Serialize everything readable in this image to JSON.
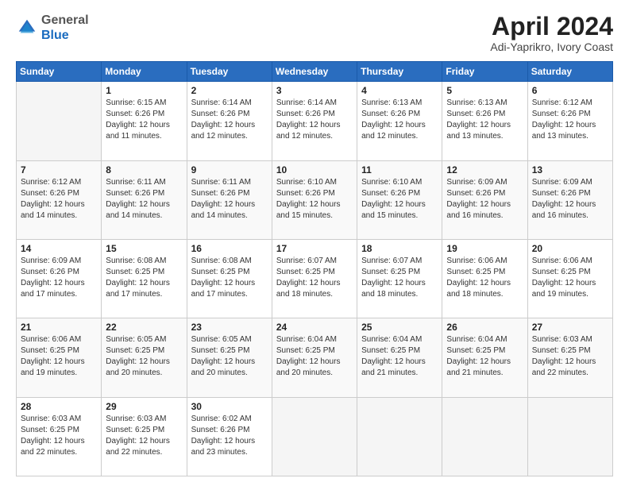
{
  "header": {
    "logo_line1": "General",
    "logo_line2": "Blue",
    "month_title": "April 2024",
    "location": "Adi-Yaprikro, Ivory Coast"
  },
  "weekdays": [
    "Sunday",
    "Monday",
    "Tuesday",
    "Wednesday",
    "Thursday",
    "Friday",
    "Saturday"
  ],
  "weeks": [
    [
      {
        "day": "",
        "info": ""
      },
      {
        "day": "1",
        "info": "Sunrise: 6:15 AM\nSunset: 6:26 PM\nDaylight: 12 hours\nand 11 minutes."
      },
      {
        "day": "2",
        "info": "Sunrise: 6:14 AM\nSunset: 6:26 PM\nDaylight: 12 hours\nand 12 minutes."
      },
      {
        "day": "3",
        "info": "Sunrise: 6:14 AM\nSunset: 6:26 PM\nDaylight: 12 hours\nand 12 minutes."
      },
      {
        "day": "4",
        "info": "Sunrise: 6:13 AM\nSunset: 6:26 PM\nDaylight: 12 hours\nand 12 minutes."
      },
      {
        "day": "5",
        "info": "Sunrise: 6:13 AM\nSunset: 6:26 PM\nDaylight: 12 hours\nand 13 minutes."
      },
      {
        "day": "6",
        "info": "Sunrise: 6:12 AM\nSunset: 6:26 PM\nDaylight: 12 hours\nand 13 minutes."
      }
    ],
    [
      {
        "day": "7",
        "info": "Sunrise: 6:12 AM\nSunset: 6:26 PM\nDaylight: 12 hours\nand 14 minutes."
      },
      {
        "day": "8",
        "info": "Sunrise: 6:11 AM\nSunset: 6:26 PM\nDaylight: 12 hours\nand 14 minutes."
      },
      {
        "day": "9",
        "info": "Sunrise: 6:11 AM\nSunset: 6:26 PM\nDaylight: 12 hours\nand 14 minutes."
      },
      {
        "day": "10",
        "info": "Sunrise: 6:10 AM\nSunset: 6:26 PM\nDaylight: 12 hours\nand 15 minutes."
      },
      {
        "day": "11",
        "info": "Sunrise: 6:10 AM\nSunset: 6:26 PM\nDaylight: 12 hours\nand 15 minutes."
      },
      {
        "day": "12",
        "info": "Sunrise: 6:09 AM\nSunset: 6:26 PM\nDaylight: 12 hours\nand 16 minutes."
      },
      {
        "day": "13",
        "info": "Sunrise: 6:09 AM\nSunset: 6:26 PM\nDaylight: 12 hours\nand 16 minutes."
      }
    ],
    [
      {
        "day": "14",
        "info": "Sunrise: 6:09 AM\nSunset: 6:26 PM\nDaylight: 12 hours\nand 17 minutes."
      },
      {
        "day": "15",
        "info": "Sunrise: 6:08 AM\nSunset: 6:25 PM\nDaylight: 12 hours\nand 17 minutes."
      },
      {
        "day": "16",
        "info": "Sunrise: 6:08 AM\nSunset: 6:25 PM\nDaylight: 12 hours\nand 17 minutes."
      },
      {
        "day": "17",
        "info": "Sunrise: 6:07 AM\nSunset: 6:25 PM\nDaylight: 12 hours\nand 18 minutes."
      },
      {
        "day": "18",
        "info": "Sunrise: 6:07 AM\nSunset: 6:25 PM\nDaylight: 12 hours\nand 18 minutes."
      },
      {
        "day": "19",
        "info": "Sunrise: 6:06 AM\nSunset: 6:25 PM\nDaylight: 12 hours\nand 18 minutes."
      },
      {
        "day": "20",
        "info": "Sunrise: 6:06 AM\nSunset: 6:25 PM\nDaylight: 12 hours\nand 19 minutes."
      }
    ],
    [
      {
        "day": "21",
        "info": "Sunrise: 6:06 AM\nSunset: 6:25 PM\nDaylight: 12 hours\nand 19 minutes."
      },
      {
        "day": "22",
        "info": "Sunrise: 6:05 AM\nSunset: 6:25 PM\nDaylight: 12 hours\nand 20 minutes."
      },
      {
        "day": "23",
        "info": "Sunrise: 6:05 AM\nSunset: 6:25 PM\nDaylight: 12 hours\nand 20 minutes."
      },
      {
        "day": "24",
        "info": "Sunrise: 6:04 AM\nSunset: 6:25 PM\nDaylight: 12 hours\nand 20 minutes."
      },
      {
        "day": "25",
        "info": "Sunrise: 6:04 AM\nSunset: 6:25 PM\nDaylight: 12 hours\nand 21 minutes."
      },
      {
        "day": "26",
        "info": "Sunrise: 6:04 AM\nSunset: 6:25 PM\nDaylight: 12 hours\nand 21 minutes."
      },
      {
        "day": "27",
        "info": "Sunrise: 6:03 AM\nSunset: 6:25 PM\nDaylight: 12 hours\nand 22 minutes."
      }
    ],
    [
      {
        "day": "28",
        "info": "Sunrise: 6:03 AM\nSunset: 6:25 PM\nDaylight: 12 hours\nand 22 minutes."
      },
      {
        "day": "29",
        "info": "Sunrise: 6:03 AM\nSunset: 6:25 PM\nDaylight: 12 hours\nand 22 minutes."
      },
      {
        "day": "30",
        "info": "Sunrise: 6:02 AM\nSunset: 6:26 PM\nDaylight: 12 hours\nand 23 minutes."
      },
      {
        "day": "",
        "info": ""
      },
      {
        "day": "",
        "info": ""
      },
      {
        "day": "",
        "info": ""
      },
      {
        "day": "",
        "info": ""
      }
    ]
  ]
}
